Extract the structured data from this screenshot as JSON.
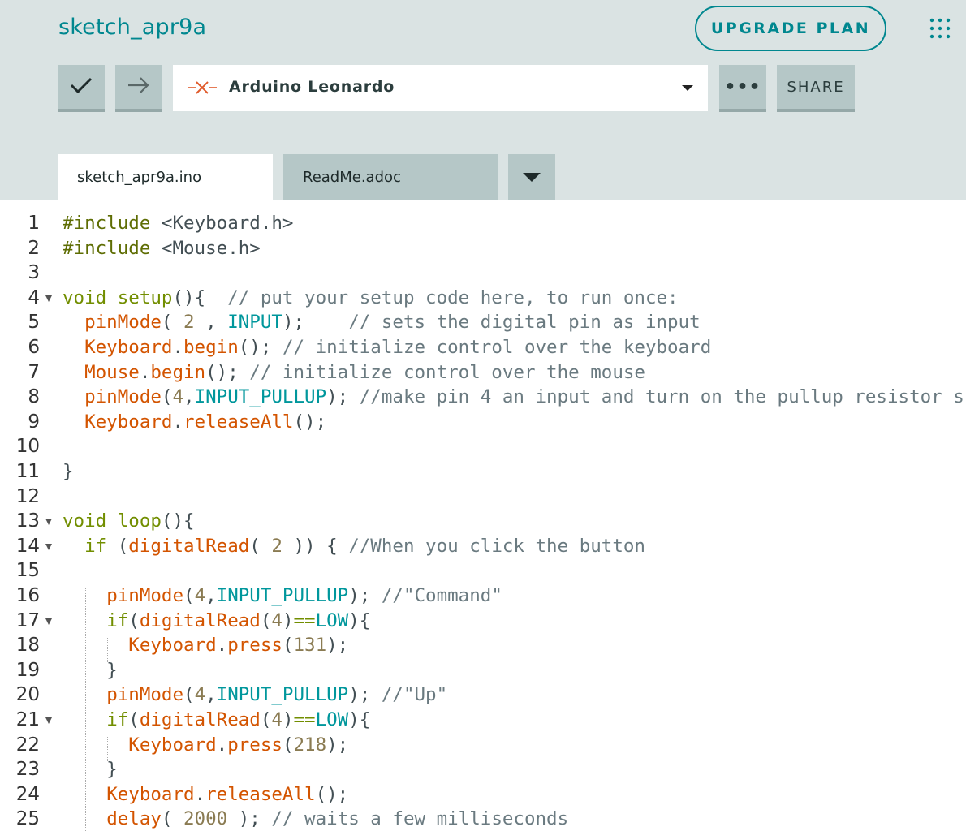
{
  "header": {
    "sketch_title": "sketch_apr9a",
    "upgrade_label": "UPGRADE PLAN",
    "apps_icon": "grid-dots-icon"
  },
  "toolbar": {
    "verify_icon": "check-icon",
    "upload_icon": "arrow-right-icon",
    "board_status_icon": "disconnected-x-icon",
    "board_label": "Arduino Leonardo",
    "more_label": "•••",
    "share_label": "SHARE"
  },
  "tabs": [
    {
      "label": "sketch_apr9a.ino",
      "active": true
    },
    {
      "label": "ReadMe.adoc",
      "active": false
    }
  ],
  "colors": {
    "accent": "#00878f",
    "background": "#dae3e3",
    "button": "#b5c7c7",
    "error_x": "#e05a2b",
    "keyword": "#728e00",
    "function": "#d35400",
    "constant": "#00979c",
    "comment": "#6a7a80"
  },
  "editor": {
    "lines": [
      {
        "n": "1",
        "fold": false,
        "tokens": [
          [
            "pr",
            "#include"
          ],
          [
            "op",
            " <Keyboard.h>"
          ]
        ]
      },
      {
        "n": "2",
        "fold": false,
        "tokens": [
          [
            "pr",
            "#include"
          ],
          [
            "op",
            " <Mouse.h>"
          ]
        ]
      },
      {
        "n": "3",
        "fold": false,
        "tokens": []
      },
      {
        "n": "4",
        "fold": true,
        "tokens": [
          [
            "kw",
            "void"
          ],
          [
            "op",
            " "
          ],
          [
            "kw",
            "setup"
          ],
          [
            "op",
            "(){  "
          ],
          [
            "cm",
            "// put your setup code here, to run once:"
          ]
        ]
      },
      {
        "n": "5",
        "fold": false,
        "tokens": [
          [
            "op",
            "  "
          ],
          [
            "fn",
            "pinMode"
          ],
          [
            "op",
            "( "
          ],
          [
            "nm",
            "2"
          ],
          [
            "op",
            " , "
          ],
          [
            "ty",
            "INPUT"
          ],
          [
            "op",
            ");    "
          ],
          [
            "cm",
            "// sets the digital pin as input"
          ]
        ]
      },
      {
        "n": "6",
        "fold": false,
        "tokens": [
          [
            "op",
            "  "
          ],
          [
            "fn",
            "Keyboard"
          ],
          [
            "op",
            "."
          ],
          [
            "fn",
            "begin"
          ],
          [
            "op",
            "(); "
          ],
          [
            "cm",
            "// initialize control over the keyboard"
          ]
        ]
      },
      {
        "n": "7",
        "fold": false,
        "tokens": [
          [
            "op",
            "  "
          ],
          [
            "fn",
            "Mouse"
          ],
          [
            "op",
            "."
          ],
          [
            "fn",
            "begin"
          ],
          [
            "op",
            "(); "
          ],
          [
            "cm",
            "// initialize control over the mouse"
          ]
        ]
      },
      {
        "n": "8",
        "fold": false,
        "tokens": [
          [
            "op",
            "  "
          ],
          [
            "fn",
            "pinMode"
          ],
          [
            "op",
            "("
          ],
          [
            "nm",
            "4"
          ],
          [
            "op",
            ","
          ],
          [
            "ty",
            "INPUT_PULLUP"
          ],
          [
            "op",
            "); "
          ],
          [
            "cm",
            "//make pin 4 an input and turn on the pullup resistor s"
          ]
        ]
      },
      {
        "n": "9",
        "fold": false,
        "tokens": [
          [
            "op",
            "  "
          ],
          [
            "fn",
            "Keyboard"
          ],
          [
            "op",
            "."
          ],
          [
            "fn",
            "releaseAll"
          ],
          [
            "op",
            "();"
          ]
        ]
      },
      {
        "n": "10",
        "fold": false,
        "tokens": []
      },
      {
        "n": "11",
        "fold": false,
        "tokens": [
          [
            "op",
            "}"
          ]
        ]
      },
      {
        "n": "12",
        "fold": false,
        "tokens": []
      },
      {
        "n": "13",
        "fold": true,
        "tokens": [
          [
            "kw",
            "void"
          ],
          [
            "op",
            " "
          ],
          [
            "kw",
            "loop"
          ],
          [
            "op",
            "(){"
          ]
        ]
      },
      {
        "n": "14",
        "fold": true,
        "tokens": [
          [
            "op",
            "  "
          ],
          [
            "kw",
            "if"
          ],
          [
            "op",
            " ("
          ],
          [
            "fn",
            "digitalRead"
          ],
          [
            "op",
            "( "
          ],
          [
            "nm",
            "2"
          ],
          [
            "op",
            " )) { "
          ],
          [
            "cm",
            "//When you click the button"
          ]
        ]
      },
      {
        "n": "15",
        "fold": false,
        "tokens": []
      },
      {
        "n": "16",
        "fold": false,
        "tokens": [
          [
            "op",
            "    "
          ],
          [
            "fn",
            "pinMode"
          ],
          [
            "op",
            "("
          ],
          [
            "nm",
            "4"
          ],
          [
            "op",
            ","
          ],
          [
            "ty",
            "INPUT_PULLUP"
          ],
          [
            "op",
            "); "
          ],
          [
            "cm",
            "//\"Command\""
          ]
        ]
      },
      {
        "n": "17",
        "fold": true,
        "tokens": [
          [
            "op",
            "    "
          ],
          [
            "kw",
            "if"
          ],
          [
            "op",
            "("
          ],
          [
            "fn",
            "digitalRead"
          ],
          [
            "op",
            "("
          ],
          [
            "nm",
            "4"
          ],
          [
            "op",
            ")"
          ],
          [
            "kw",
            "=="
          ],
          [
            "ty",
            "LOW"
          ],
          [
            "op",
            "){"
          ]
        ]
      },
      {
        "n": "18",
        "fold": false,
        "tokens": [
          [
            "op",
            "      "
          ],
          [
            "fn",
            "Keyboard"
          ],
          [
            "op",
            "."
          ],
          [
            "fn",
            "press"
          ],
          [
            "op",
            "("
          ],
          [
            "nm",
            "131"
          ],
          [
            "op",
            ");"
          ]
        ]
      },
      {
        "n": "19",
        "fold": false,
        "tokens": [
          [
            "op",
            "    }"
          ]
        ]
      },
      {
        "n": "20",
        "fold": false,
        "tokens": [
          [
            "op",
            "    "
          ],
          [
            "fn",
            "pinMode"
          ],
          [
            "op",
            "("
          ],
          [
            "nm",
            "4"
          ],
          [
            "op",
            ","
          ],
          [
            "ty",
            "INPUT_PULLUP"
          ],
          [
            "op",
            "); "
          ],
          [
            "cm",
            "//\"Up\""
          ]
        ]
      },
      {
        "n": "21",
        "fold": true,
        "tokens": [
          [
            "op",
            "    "
          ],
          [
            "kw",
            "if"
          ],
          [
            "op",
            "("
          ],
          [
            "fn",
            "digitalRead"
          ],
          [
            "op",
            "("
          ],
          [
            "nm",
            "4"
          ],
          [
            "op",
            ")"
          ],
          [
            "kw",
            "=="
          ],
          [
            "ty",
            "LOW"
          ],
          [
            "op",
            "){"
          ]
        ]
      },
      {
        "n": "22",
        "fold": false,
        "tokens": [
          [
            "op",
            "      "
          ],
          [
            "fn",
            "Keyboard"
          ],
          [
            "op",
            "."
          ],
          [
            "fn",
            "press"
          ],
          [
            "op",
            "("
          ],
          [
            "nm",
            "218"
          ],
          [
            "op",
            ");"
          ]
        ]
      },
      {
        "n": "23",
        "fold": false,
        "tokens": [
          [
            "op",
            "    }"
          ]
        ]
      },
      {
        "n": "24",
        "fold": false,
        "tokens": [
          [
            "op",
            "    "
          ],
          [
            "fn",
            "Keyboard"
          ],
          [
            "op",
            "."
          ],
          [
            "fn",
            "releaseAll"
          ],
          [
            "op",
            "();"
          ]
        ]
      },
      {
        "n": "25",
        "fold": false,
        "tokens": [
          [
            "op",
            "    "
          ],
          [
            "fn",
            "delay"
          ],
          [
            "op",
            "( "
          ],
          [
            "nm",
            "2000"
          ],
          [
            "op",
            " ); "
          ],
          [
            "cm",
            "// waits a few milliseconds"
          ]
        ]
      }
    ]
  }
}
